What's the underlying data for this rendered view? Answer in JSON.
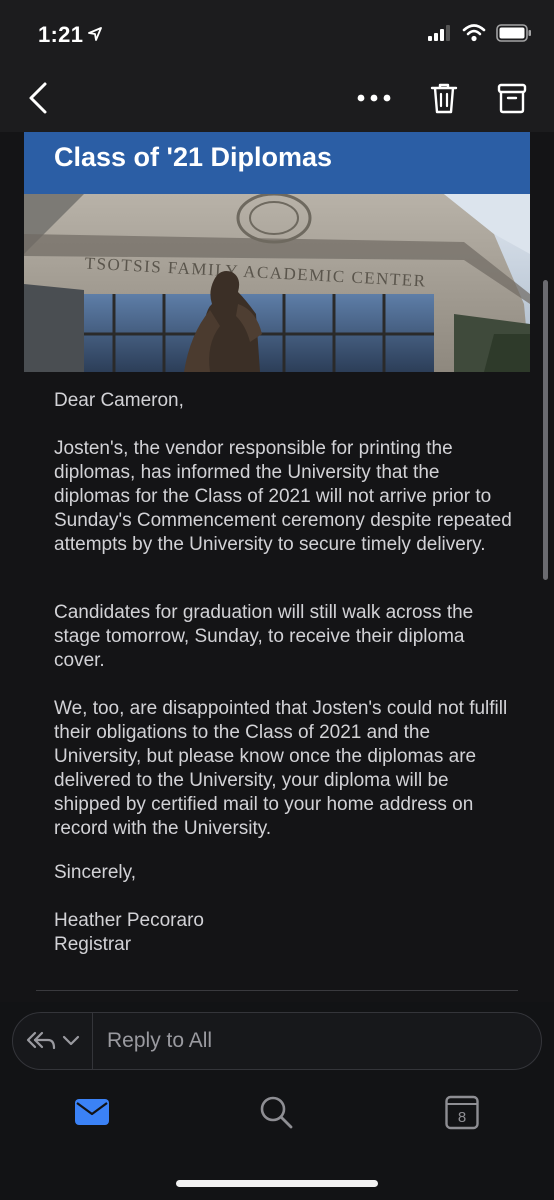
{
  "status": {
    "time": "1:21"
  },
  "nav": {
    "back_icon": "chevron-left-icon",
    "more_icon": "ellipsis-icon",
    "delete_icon": "trash-icon",
    "archive_icon": "archive-icon"
  },
  "email": {
    "banner_title": "Class of '21 Diplomas",
    "hero_sign": "TSOTSIS FAMILY ACADEMIC CENTER",
    "greeting": "Dear Cameron,",
    "paragraph1": "Josten's, the vendor responsible for printing the diplomas, has informed the University that the diplomas for the Class of 2021 will not arrive prior to Sunday's Commencement ceremony despite repeated attempts by the University to secure timely delivery.",
    "paragraph2": "Candidates for graduation will still walk across the stage tomorrow, Sunday, to receive their diploma cover.",
    "paragraph3": "We, too, are disappointed that Josten's could not fulfill their obligations to the Class of 2021 and the University, but please know once the diplomas are delivered to the University, your diploma will be shipped by certified mail to your home address on record with the University.",
    "closing": "Sincerely,",
    "signature_name": "Heather Pecoraro",
    "signature_title": "Registrar"
  },
  "reply": {
    "placeholder": "Reply to All"
  },
  "tabs": {
    "calendar_day": "8"
  },
  "colors": {
    "banner": "#2b5ea5",
    "accent": "#3b82f6"
  }
}
